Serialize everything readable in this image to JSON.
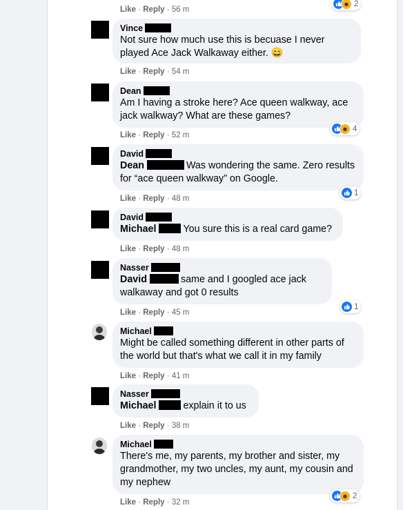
{
  "top_meta": {
    "like": "Like",
    "reply": "Reply",
    "time": "56 m",
    "reactions": "2"
  },
  "comments": [
    {
      "author": "Vince",
      "text": "Not sure how much use this is becuase I never played Ace Jack Walkaway either. 😄",
      "like": "Like",
      "reply": "Reply",
      "time": "54 m"
    },
    {
      "author": "Dean",
      "text": "Am I having a stroke here? Ace queen walkway, ace jack walkway? What are these games?",
      "like": "Like",
      "reply": "Reply",
      "time": "52 m",
      "reactions": "4"
    },
    {
      "author": "David",
      "mention": "Dean",
      "text": "Was wondering the same. Zero results for “ace queen walkway” on Google.",
      "like": "Like",
      "reply": "Reply",
      "time": "48 m",
      "reactions": "1"
    },
    {
      "author": "David",
      "mention": "Michael",
      "text": "You sure this is a real card game?",
      "like": "Like",
      "reply": "Reply",
      "time": "48 m"
    },
    {
      "author": "Nasser",
      "mention": "David",
      "text": "same and I googled ace jack walkaway and got 0 results",
      "like": "Like",
      "reply": "Reply",
      "time": "45 m",
      "reactions": "1"
    },
    {
      "author": "Michael",
      "text": "Might be called something different in other parts of the world but that's what we call it in my family",
      "like": "Like",
      "reply": "Reply",
      "time": "41 m"
    },
    {
      "author": "Nasser",
      "mention": "Michael",
      "text": "explain it to us",
      "like": "Like",
      "reply": "Reply",
      "time": "38 m"
    },
    {
      "author": "Michael",
      "text": "There's me, my parents, my brother and sister, my grandmother, my two uncles, my aunt, my cousin and my nephew",
      "like": "Like",
      "reply": "Reply",
      "time": "32 m",
      "reactions": "2"
    }
  ],
  "colors": {
    "like_blue": "#1877f2",
    "haha_yellow": "#f7b125",
    "bubble": "#f0f2f5",
    "meta_gray": "#65676b"
  }
}
